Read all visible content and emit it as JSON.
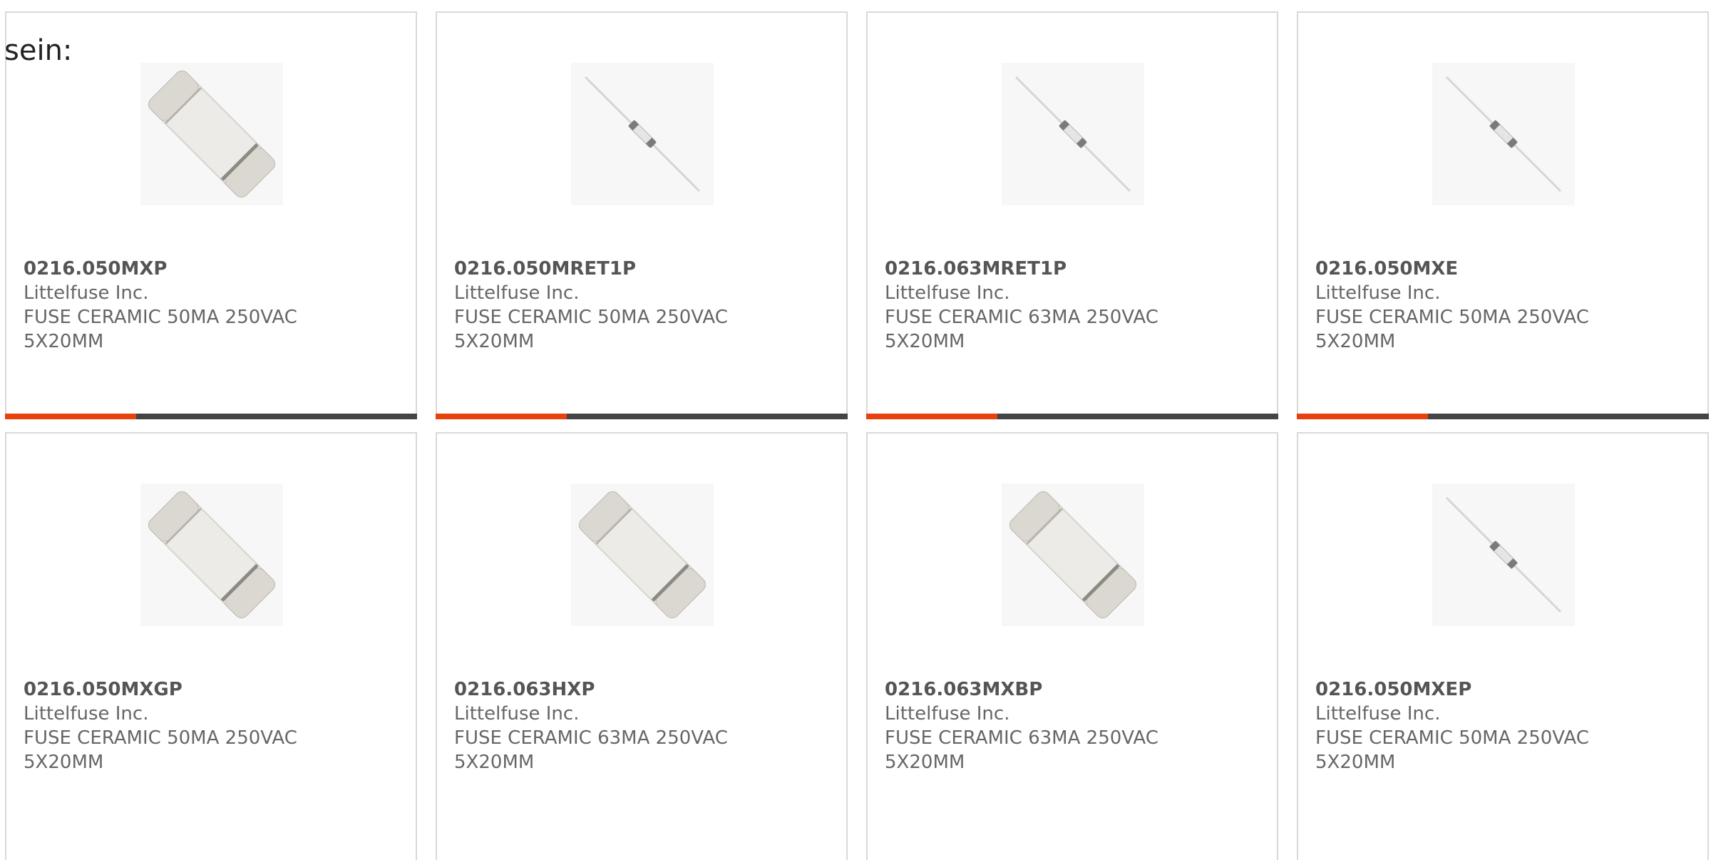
{
  "intro_text": "sein:",
  "colors": {
    "accent": "#e8410e",
    "bar_dark": "#444444",
    "card_border": "#d9d9d9",
    "text": "#666666"
  },
  "products": [
    {
      "part_number": "0216.050MXP",
      "manufacturer": "Littelfuse Inc.",
      "description": "FUSE CERAMIC 50MA 250VAC 5X20MM",
      "image": "ceramic-cartridge-fuse-icon"
    },
    {
      "part_number": "0216.050MRET1P",
      "manufacturer": "Littelfuse Inc.",
      "description": "FUSE CERAMIC 50MA 250VAC 5X20MM",
      "image": "axial-lead-fuse-icon"
    },
    {
      "part_number": "0216.063MRET1P",
      "manufacturer": "Littelfuse Inc.",
      "description": "FUSE CERAMIC 63MA 250VAC 5X20MM",
      "image": "axial-lead-fuse-icon"
    },
    {
      "part_number": "0216.050MXE",
      "manufacturer": "Littelfuse Inc.",
      "description": "FUSE CERAMIC 50MA 250VAC 5X20MM",
      "image": "axial-lead-fuse-icon"
    },
    {
      "part_number": "0216.050MXGP",
      "manufacturer": "Littelfuse Inc.",
      "description": "FUSE CERAMIC 50MA 250VAC 5X20MM",
      "image": "ceramic-cartridge-fuse-icon"
    },
    {
      "part_number": "0216.063HXP",
      "manufacturer": "Littelfuse Inc.",
      "description": "FUSE CERAMIC 63MA 250VAC 5X20MM",
      "image": "ceramic-cartridge-fuse-icon"
    },
    {
      "part_number": "0216.063MXBP",
      "manufacturer": "Littelfuse Inc.",
      "description": "FUSE CERAMIC 63MA 250VAC 5X20MM",
      "image": "ceramic-cartridge-fuse-icon"
    },
    {
      "part_number": "0216.050MXEP",
      "manufacturer": "Littelfuse Inc.",
      "description": "FUSE CERAMIC 50MA 250VAC 5X20MM",
      "image": "axial-lead-fuse-icon"
    }
  ]
}
